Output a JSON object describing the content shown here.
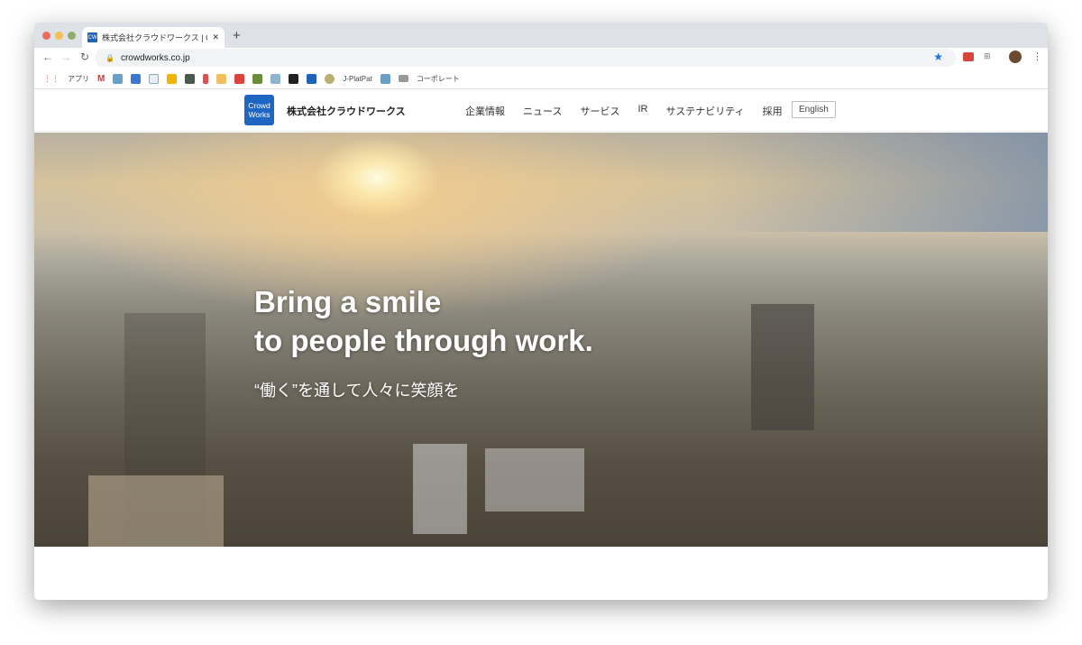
{
  "browser": {
    "tab_title": "株式会社クラウドワークス | Crowdworks",
    "tab_favicon": "CW",
    "url": "crowdworks.co.jp",
    "bookmarks": {
      "apps": "アプリ",
      "jplatpat": "J-PlatPat",
      "corporate": "コーポレート"
    }
  },
  "site": {
    "logo_line1": "Crowd",
    "logo_line2": "Works",
    "company_name": "株式会社クラウドワークス",
    "nav": [
      "企業情報",
      "ニュース",
      "サービス",
      "IR",
      "サステナビリティ",
      "採用"
    ],
    "language_button": "English",
    "accent": "#1d66c2"
  },
  "hero": {
    "headline_line1": "Bring a smile",
    "headline_line2": "to people through work.",
    "subheadline": "“働く”を通して人々に笑顔を"
  }
}
